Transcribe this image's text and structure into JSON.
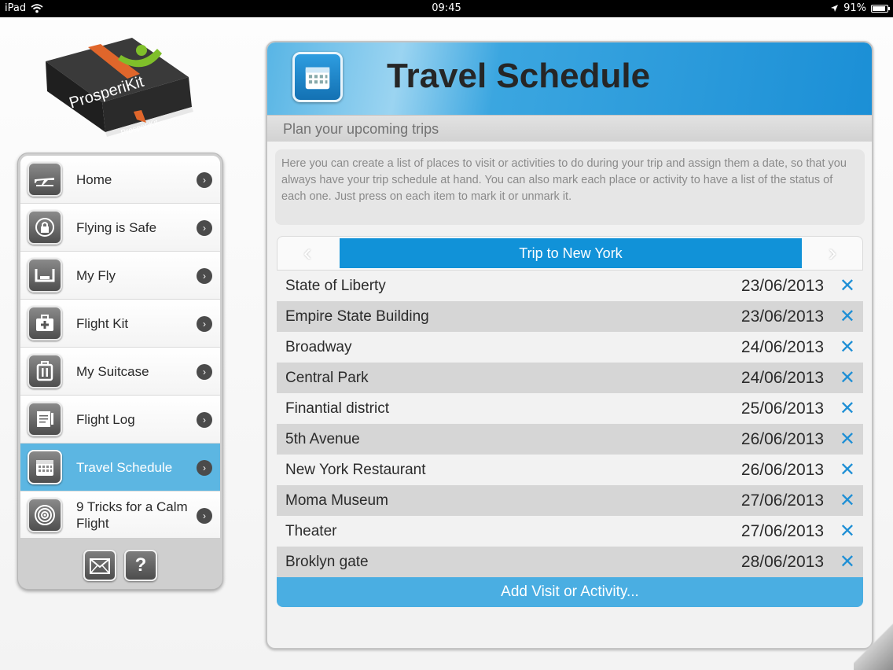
{
  "status_bar": {
    "device": "iPad",
    "time": "09:45",
    "battery": "91%",
    "battery_level": 0.91
  },
  "logo": {
    "brand_top": "ProsperiKit",
    "brand_side": "ProsperiKit"
  },
  "menu": {
    "items": [
      {
        "label": "Home",
        "icon": "airplane-icon",
        "active": false
      },
      {
        "label": "Flying is Safe",
        "icon": "lock-icon",
        "active": false
      },
      {
        "label": "My Fly",
        "icon": "seat-icon",
        "active": false
      },
      {
        "label": "Flight Kit",
        "icon": "first-aid-kit-icon",
        "active": false
      },
      {
        "label": "My Suitcase",
        "icon": "suitcase-icon",
        "active": false
      },
      {
        "label": "Flight Log",
        "icon": "notebook-icon",
        "active": false
      },
      {
        "label": "Travel Schedule",
        "icon": "calendar-icon",
        "active": true
      },
      {
        "label": "9 Tricks for a Calm Flight",
        "icon": "target-icon",
        "active": false
      }
    ],
    "footer": {
      "mail_icon": "mail-icon",
      "help_label": "?"
    }
  },
  "panel": {
    "title": "Travel Schedule",
    "subtitle": "Plan your upcoming trips",
    "intro": "Here you can create a list of places to visit or activities to do during your trip and assign them a date, so that you always have your trip schedule at hand. You can also mark each place or activity to have a list of the status of each one. Just press on each item to mark it or unmark it.",
    "trip": {
      "prev": "‹",
      "title": "Trip to New York",
      "next": "›"
    },
    "items": [
      {
        "name": "State of Liberty",
        "date": "23/06/2013"
      },
      {
        "name": "Empire State Building",
        "date": "23/06/2013"
      },
      {
        "name": "Broadway",
        "date": "24/06/2013"
      },
      {
        "name": "Central Park",
        "date": "24/06/2013"
      },
      {
        "name": "Finantial district",
        "date": "25/06/2013"
      },
      {
        "name": "5th Avenue",
        "date": "26/06/2013"
      },
      {
        "name": "New York Restaurant",
        "date": "26/06/2013"
      },
      {
        "name": "Moma Museum",
        "date": "27/06/2013"
      },
      {
        "name": "Theater",
        "date": "27/06/2013"
      },
      {
        "name": "Broklyn gate",
        "date": "28/06/2013"
      }
    ],
    "delete_glyph": "✕",
    "add_label": "Add Visit or Activity..."
  },
  "colors": {
    "accent": "#1192d8",
    "active_menu": "#5cb6e2",
    "add_button": "#4aaee2",
    "delete_icon": "#1e8fd5"
  }
}
